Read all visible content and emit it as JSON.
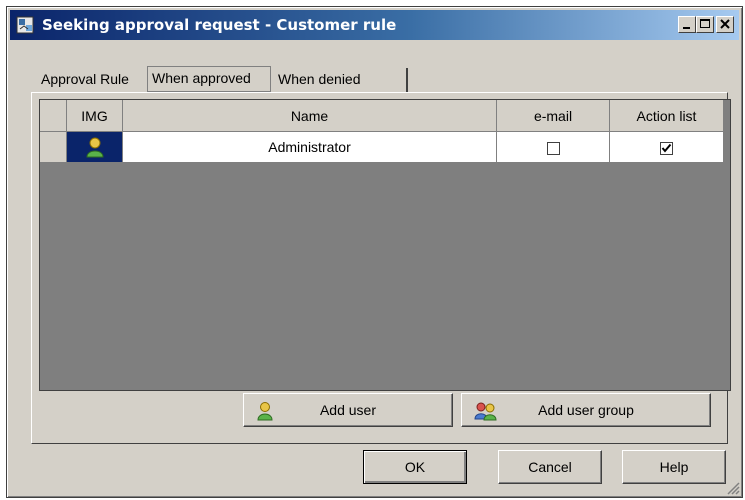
{
  "window": {
    "title": "Seeking approval request - Customer rule",
    "controls": {
      "minimize": "_",
      "maximize": "□",
      "close": "×"
    }
  },
  "tabs": [
    {
      "label": "Approval Rule",
      "selected": false
    },
    {
      "label": "When approved",
      "selected": true
    },
    {
      "label": "When denied",
      "selected": false
    }
  ],
  "table": {
    "columns": [
      "IMG",
      "Name",
      "e-mail",
      "Action list"
    ],
    "rows": [
      {
        "img": "user-icon",
        "name": "Administrator",
        "email": false,
        "action_list": true
      }
    ]
  },
  "buttons": {
    "add_user": "Add user",
    "add_user_group": "Add user group",
    "ok": "OK",
    "cancel": "Cancel",
    "help": "Help"
  },
  "colors": {
    "title_bar_start": "#0a246a",
    "title_bar_end": "#a6caf0",
    "dialog_face": "#d4d0c8",
    "grid_empty_area": "#7f7f7f",
    "selected_cell": "#0a246a"
  }
}
